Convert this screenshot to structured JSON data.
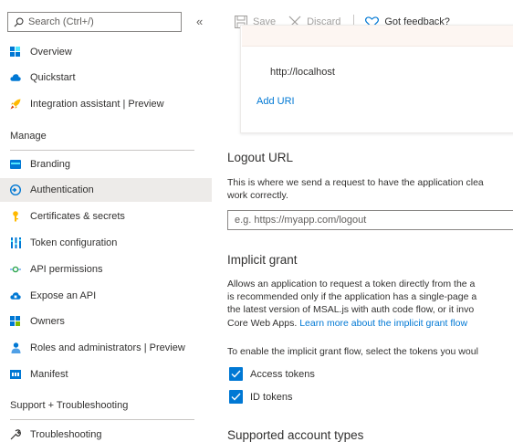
{
  "sidebar": {
    "search_placeholder": "Search (Ctrl+/)",
    "collapse_glyph": "«",
    "items_top": [
      {
        "label": "Overview",
        "icon": "overview-grid-icon"
      },
      {
        "label": "Quickstart",
        "icon": "quickstart-cloud-icon"
      },
      {
        "label": "Integration assistant | Preview",
        "icon": "rocket-icon"
      }
    ],
    "manage_header": "Manage",
    "items_manage": [
      {
        "label": "Branding",
        "icon": "branding-icon"
      },
      {
        "label": "Authentication",
        "icon": "authentication-icon",
        "selected": true
      },
      {
        "label": "Certificates & secrets",
        "icon": "key-icon"
      },
      {
        "label": "Token configuration",
        "icon": "token-bars-icon"
      },
      {
        "label": "API permissions",
        "icon": "api-permissions-icon"
      },
      {
        "label": "Expose an API",
        "icon": "expose-api-cloud-icon"
      },
      {
        "label": "Owners",
        "icon": "owners-grid-icon"
      },
      {
        "label": "Roles and administrators | Preview",
        "icon": "roles-user-icon"
      },
      {
        "label": "Manifest",
        "icon": "manifest-icon"
      }
    ],
    "support_header": "Support + Troubleshooting",
    "items_support": [
      {
        "label": "Troubleshooting",
        "icon": "troubleshooting-icon"
      }
    ]
  },
  "toolbar": {
    "save_label": "Save",
    "discard_label": "Discard",
    "feedback_label": "Got feedback?"
  },
  "redirect": {
    "uri_value": "http://localhost",
    "add_uri_label": "Add URI"
  },
  "logout": {
    "heading": "Logout URL",
    "description_line1": "This is where we send a request to have the application clea",
    "description_line2": "work correctly.",
    "placeholder": "e.g. https://myapp.com/logout"
  },
  "implicit": {
    "heading": "Implicit grant",
    "line1": "Allows an application to request a token directly from the a",
    "line2": "is recommended only if the application has a single-page a",
    "line3": "the latest version of MSAL.js with auth code flow, or it invo",
    "line4_text": "Core Web Apps. ",
    "learn_more": "Learn more about the implicit grant flow",
    "enable_text": "To enable the implicit grant flow, select the tokens you woul",
    "checkboxes": [
      {
        "label": "Access tokens",
        "checked": true
      },
      {
        "label": "ID tokens",
        "checked": true
      }
    ],
    "next_heading_partial": "Supported account types"
  },
  "colors": {
    "accent": "#0078d4",
    "selected_bg": "#edebe9",
    "text": "#323130",
    "disabled": "#a19f9d"
  }
}
